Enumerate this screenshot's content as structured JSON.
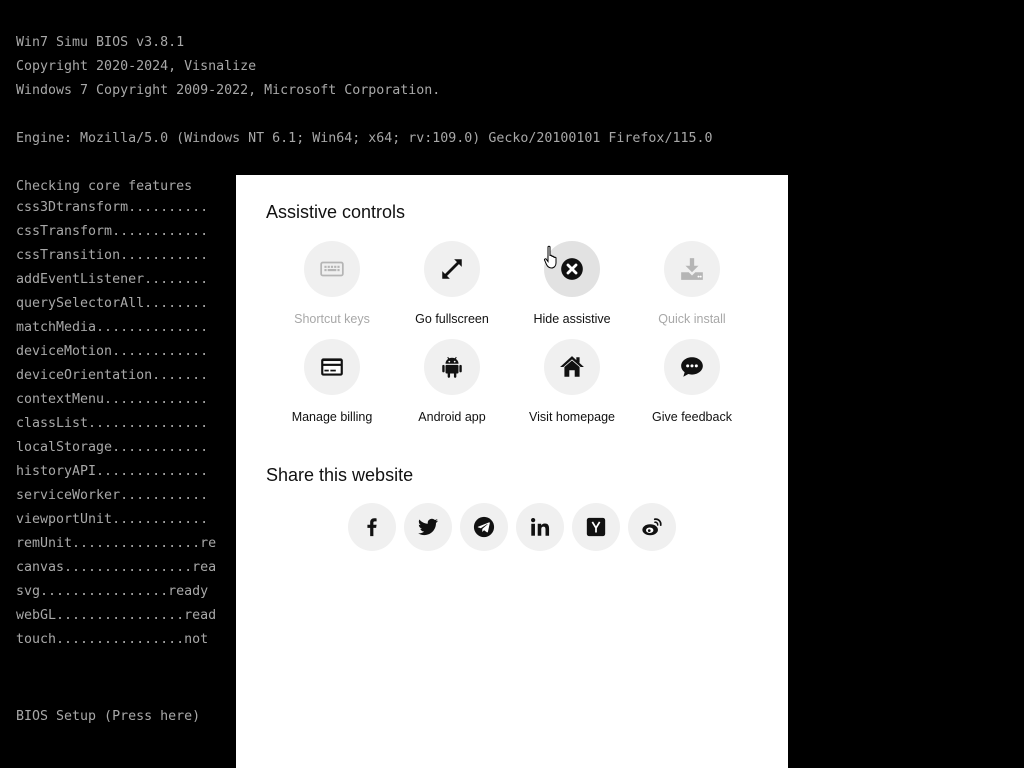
{
  "bios": {
    "header_lines": [
      "Win7 Simu BIOS v3.8.1",
      "Copyright 2020-2024, Visnalize",
      "Windows 7 Copyright 2009-2022, Microsoft Corporation."
    ],
    "engine_line": "Engine: Mozilla/5.0 (Windows NT 6.1; Win64; x64; rv:109.0) Gecko/20100101 Firefox/115.0",
    "checking_title": "Checking core features",
    "features": [
      "css3Dtransform..........",
      "cssTransform............",
      "cssTransition...........",
      "addEventListener........",
      "querySelectorAll........",
      "matchMedia..............",
      "deviceMotion............",
      "deviceOrientation.......",
      "contextMenu.............",
      "classList...............",
      "localStorage............",
      "historyAPI..............",
      "serviceWorker...........",
      "viewportUnit............",
      "remUnit................re",
      "canvas................rea",
      "svg................ready",
      "webGL................read",
      "touch................not"
    ],
    "setup_link": "BIOS Setup (Press here)"
  },
  "modal": {
    "assistive_title": "Assistive controls",
    "controls": [
      {
        "label": "Shortcut keys",
        "icon": "keyboard-icon",
        "enabled": false
      },
      {
        "label": "Go fullscreen",
        "icon": "expand-icon",
        "enabled": true
      },
      {
        "label": "Hide assistive",
        "icon": "close-circle-icon",
        "enabled": true
      },
      {
        "label": "Quick install",
        "icon": "download-icon",
        "enabled": false
      },
      {
        "label": "Manage billing",
        "icon": "credit-card-icon",
        "enabled": true
      },
      {
        "label": "Android app",
        "icon": "android-icon",
        "enabled": true
      },
      {
        "label": "Visit homepage",
        "icon": "home-icon",
        "enabled": true
      },
      {
        "label": "Give feedback",
        "icon": "chat-icon",
        "enabled": true
      }
    ],
    "share_title": "Share this website",
    "share_icons": [
      "facebook-icon",
      "twitter-icon",
      "telegram-icon",
      "linkedin-icon",
      "ycombinator-icon",
      "weibo-icon"
    ]
  },
  "colors": {
    "bios_background": "#000000",
    "bios_text": "#a8a8a8",
    "modal_background": "#ffffff",
    "button_background": "#f0f0f0",
    "disabled_text": "#a8a8a8",
    "icon": "#111111"
  }
}
